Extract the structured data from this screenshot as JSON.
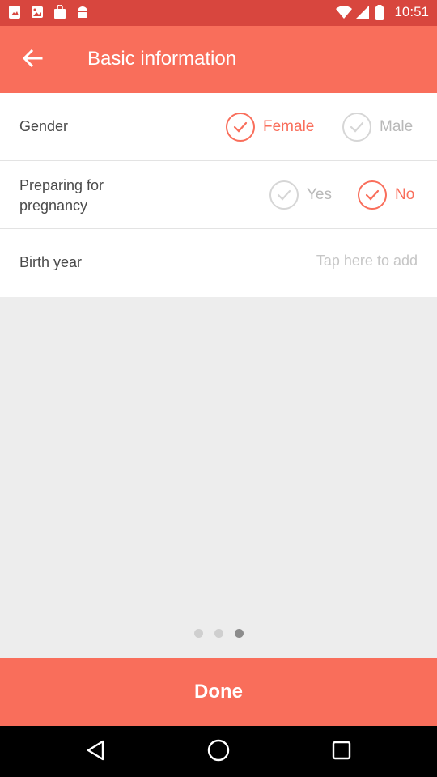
{
  "status_bar": {
    "time": "10:51",
    "icons": [
      "gallery-icon",
      "image-icon",
      "shopping-bag-icon",
      "android-icon",
      "wifi-icon",
      "cellular-signal-icon",
      "battery-icon"
    ]
  },
  "app_bar": {
    "title": "Basic information",
    "back_icon": "arrow-left-icon"
  },
  "form": {
    "gender": {
      "label": "Gender",
      "options": [
        {
          "label": "Female",
          "selected": true
        },
        {
          "label": "Male",
          "selected": false
        }
      ]
    },
    "pregnancy": {
      "label": "Preparing for pregnancy",
      "options": [
        {
          "label": "Yes",
          "selected": false
        },
        {
          "label": "No",
          "selected": true
        }
      ]
    },
    "birth_year": {
      "label": "Birth year",
      "placeholder": "Tap here to add"
    }
  },
  "pager": {
    "total": 3,
    "active_index": 2
  },
  "done_button": {
    "label": "Done"
  },
  "colors": {
    "accent": "#f96e5b",
    "status_bar": "#d8463e",
    "inactive_check": "#d6d6d6",
    "background": "#ededed"
  },
  "nav_bar": {
    "icons": [
      "back-triangle-icon",
      "home-circle-icon",
      "recents-square-icon"
    ]
  }
}
